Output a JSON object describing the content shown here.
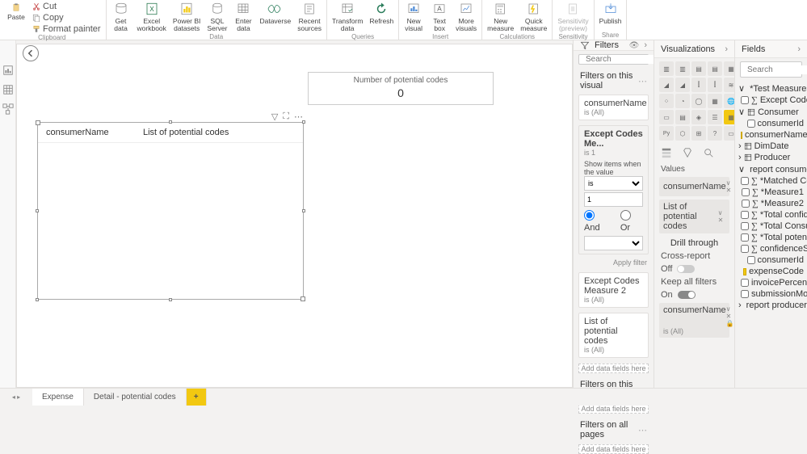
{
  "ribbon": {
    "clipboard": {
      "paste": "Paste",
      "cut": "Cut",
      "copy": "Copy",
      "fmt": "Format painter",
      "grp": "Clipboard"
    },
    "data": {
      "get": "Get\ndata",
      "excel": "Excel\nworkbook",
      "pbi": "Power BI\ndatasets",
      "sql": "SQL\nServer",
      "enter": "Enter\ndata",
      "dv": "Dataverse",
      "recent": "Recent\nsources",
      "grp": "Data"
    },
    "queries": {
      "transform": "Transform\ndata",
      "refresh": "Refresh",
      "grp": "Queries"
    },
    "insert": {
      "newv": "New\nvisual",
      "text": "Text\nbox",
      "more": "More\nvisuals",
      "grp": "Insert"
    },
    "calc": {
      "meas": "New\nmeasure",
      "quick": "Quick\nmeasure",
      "grp": "Calculations"
    },
    "sens": {
      "lbl": "Sensitivity\n(preview)",
      "grp": "Sensitivity"
    },
    "share": {
      "pub": "Publish",
      "grp": "Share"
    }
  },
  "canvas": {
    "card_title": "Number of potential codes",
    "card_value": "0",
    "col1": "consumerName",
    "col2": "List of potential codes"
  },
  "filters": {
    "title": "Filters",
    "search": "Search",
    "on_visual": "Filters on this visual",
    "c1": "consumerName",
    "c1s": "is (All)",
    "c2": "Except Codes Me...",
    "c2s": "is 1",
    "show_when": "Show items when the value",
    "op": "is",
    "val": "1",
    "and": "And",
    "or": "Or",
    "apply": "Apply filter",
    "c3": "Except Codes Measure 2",
    "c3s": "is (All)",
    "c4": "List of potential codes",
    "c4s": "is (All)",
    "add": "Add data fields here",
    "on_page": "Filters on this page",
    "on_all": "Filters on all pages"
  },
  "viz": {
    "title": "Visualizations",
    "values": "Values",
    "f1": "consumerName",
    "f2": "List of potential codes",
    "drill": "Drill through",
    "cross": "Cross-report",
    "off": "Off",
    "keep": "Keep all filters",
    "on": "On",
    "d1": "consumerName",
    "d1s": "is (All)"
  },
  "fields": {
    "title": "Fields",
    "search": "Search",
    "t1": "*Test Measures",
    "t1a": "Except Codes Me...",
    "t2": "Consumer",
    "t2a": "consumerId",
    "t2b": "consumerName",
    "t3": "DimDate",
    "t4": "Producer",
    "t5": "report consumerExpens...",
    "t5a": "*Matched Column",
    "t5b": "*Measure1",
    "t5c": "*Measure2",
    "t5d": "*Total confidence...",
    "t5e": "*Total ConsumerE...",
    "t5f": "*Total potentialEx...",
    "t5g": "confidenceScore",
    "t5h": "consumerId",
    "t5i": "expenseCode",
    "t5j": "invoicePercentage",
    "t5k": "submissionMonth",
    "t6": "report producerConsu..."
  },
  "tabs": {
    "t1": "Expense",
    "t2": "Detail - potential codes",
    "add": "+"
  }
}
